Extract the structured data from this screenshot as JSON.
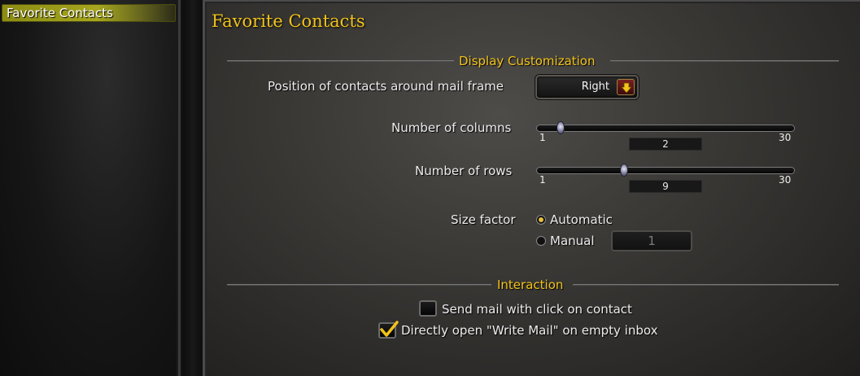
{
  "sidebar": {
    "items": [
      {
        "label": "Favorite Contacts",
        "selected": true
      }
    ]
  },
  "panel": {
    "title": "Favorite Contacts"
  },
  "display_section": {
    "title": "Display Customization",
    "position_label": "Position of contacts around mail frame",
    "position_value": "Right",
    "columns": {
      "label": "Number of columns",
      "min": "1",
      "max": "30",
      "value": "2"
    },
    "rows": {
      "label": "Number of rows",
      "min": "1",
      "max": "30",
      "value": "9"
    },
    "size_factor": {
      "label": "Size factor",
      "options": [
        {
          "label": "Automatic",
          "selected": true
        },
        {
          "label": "Manual",
          "selected": false
        }
      ],
      "manual_value": "1"
    }
  },
  "interaction_section": {
    "title": "Interaction",
    "send_mail": {
      "label": "Send mail with click on contact",
      "checked": false
    },
    "open_write_mail": {
      "label": "Directly open \"Write Mail\" on empty inbox",
      "checked": true
    }
  },
  "colors": {
    "accent_gold": "#f2c31a",
    "selected_item": "#a6a61e"
  }
}
